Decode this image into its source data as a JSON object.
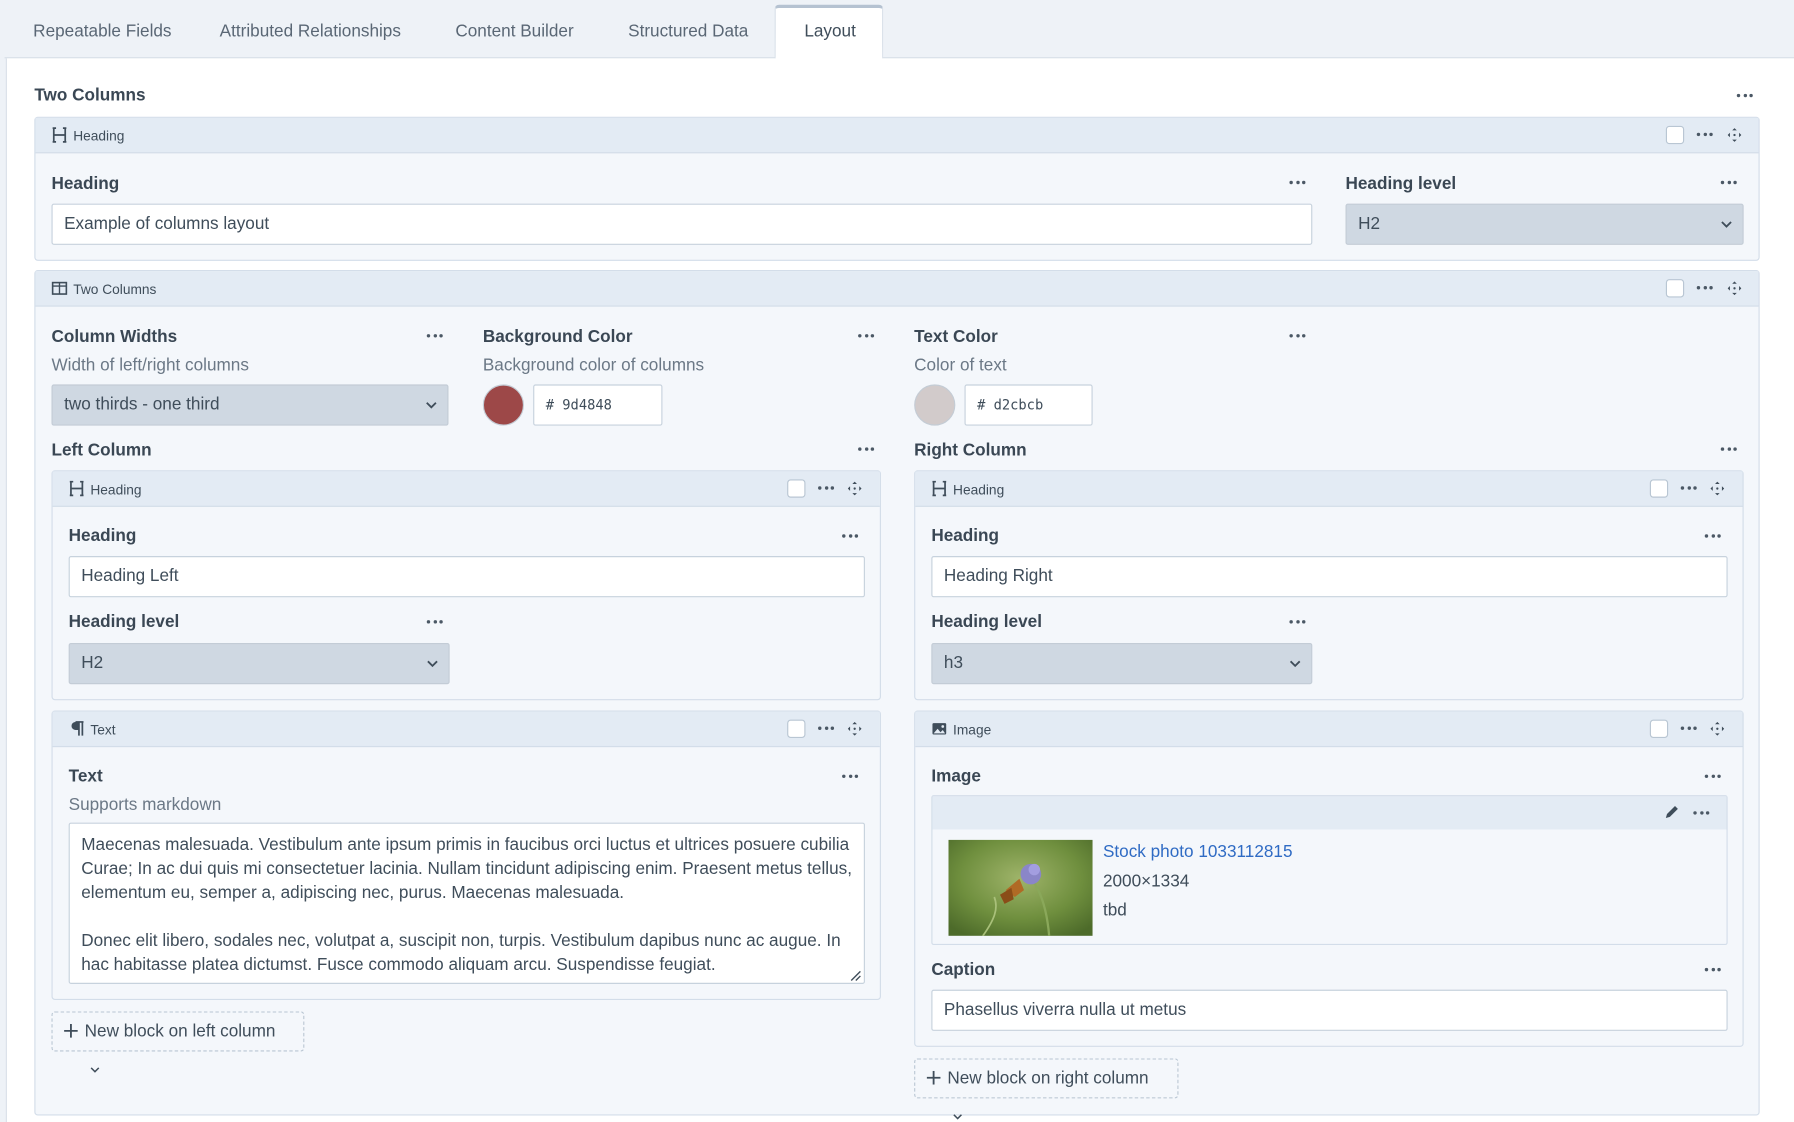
{
  "tabs": [
    {
      "label": "Repeatable Fields"
    },
    {
      "label": "Attributed Relationships"
    },
    {
      "label": "Content Builder"
    },
    {
      "label": "Structured Data"
    },
    {
      "label": "Layout",
      "active": true
    }
  ],
  "field_title": "Two Columns",
  "heading_block": {
    "type_label": "Heading",
    "heading_label": "Heading",
    "heading_value": "Example of columns layout",
    "level_label": "Heading level",
    "level_value": "H2"
  },
  "columns_block": {
    "type_label": "Two Columns",
    "column_widths": {
      "label": "Column Widths",
      "help": "Width of left/right columns",
      "value": "two thirds - one third"
    },
    "background_color": {
      "label": "Background Color",
      "help": "Background color of columns",
      "hex": "# 9d4848",
      "color": "#9d4848"
    },
    "text_color": {
      "label": "Text Color",
      "help": "Color of text",
      "hex": "# d2cbcb",
      "color": "#d2cbcb"
    },
    "left": {
      "label": "Left Column",
      "heading_block": {
        "type_label": "Heading",
        "heading_label": "Heading",
        "heading_value": "Heading Left",
        "level_label": "Heading level",
        "level_value": "H2"
      },
      "text_block": {
        "type_label": "Text",
        "text_label": "Text",
        "help": "Supports markdown",
        "value": "Maecenas malesuada. Vestibulum ante ipsum primis in faucibus orci luctus et ultrices posuere cubilia Curae; In ac dui quis mi consectetuer lacinia. Nullam tincidunt adipiscing enim. Praesent metus tellus, elementum eu, semper a, adipiscing nec, purus. Maecenas malesuada.\n\nDonec elit libero, sodales nec, volutpat a, suscipit non, turpis. Vestibulum dapibus nunc ac augue. In hac habitasse platea dictumst. Fusce commodo aliquam arcu. Suspendisse feugiat."
      },
      "new_block_label": "New block on left column"
    },
    "right": {
      "label": "Right Column",
      "heading_block": {
        "type_label": "Heading",
        "heading_label": "Heading",
        "heading_value": "Heading Right",
        "level_label": "Heading level",
        "level_value": "h3"
      },
      "image_block": {
        "type_label": "Image",
        "image_label": "Image",
        "image_title": "Stock photo 1033112815",
        "image_dims": "2000×1334",
        "image_note": "tbd",
        "caption_label": "Caption",
        "caption_value": "Phasellus viverra nulla ut metus"
      },
      "new_block_label": "New block on right column"
    }
  },
  "icons": [
    "heading-icon",
    "columns-icon",
    "paragraph-icon",
    "image-icon",
    "more-dots-icon",
    "move-icon",
    "chevron-down-icon",
    "plus-icon",
    "pencil-icon"
  ],
  "colors": {
    "accent_link": "#2f6bc4",
    "block_header": "#e3ebf4",
    "block_body": "#f4f7fb",
    "select_bg": "#cfd8e2"
  }
}
